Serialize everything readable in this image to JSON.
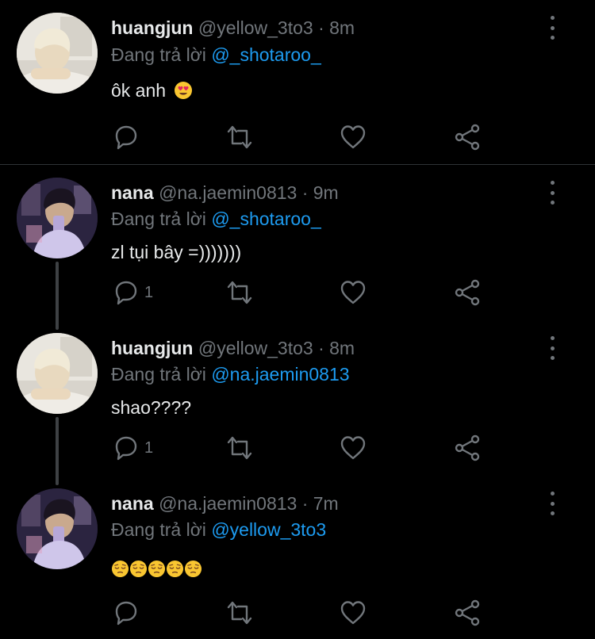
{
  "tweets": [
    {
      "name": "huangjun",
      "handle": "@yellow_3to3",
      "time": "· 8m",
      "reply_prefix": "Đang trả lời ",
      "reply_to": "@_shotaroo_",
      "text": "ôk anh",
      "emoji": "heart-eyes",
      "reply_count": ""
    },
    {
      "name": "nana",
      "handle": "@na.jaemin0813",
      "time": "· 9m",
      "reply_prefix": "Đang trả lời ",
      "reply_to": "@_shotaroo_",
      "text": "zl tụi bây =)))))))",
      "reply_count": "1"
    },
    {
      "name": "huangjun",
      "handle": "@yellow_3to3",
      "time": "· 8m",
      "reply_prefix": "Đang trả lời ",
      "reply_to": "@na.jaemin0813",
      "text": "shao????",
      "reply_count": "1"
    },
    {
      "name": "nana",
      "handle": "@na.jaemin0813",
      "time": "· 7m",
      "reply_prefix": "Đang trả lời ",
      "reply_to": "@yellow_3to3",
      "text": "",
      "emoji": "pensive x5",
      "reply_count": ""
    }
  ],
  "colors": {
    "background": "#000000",
    "text": "#e7e9ea",
    "muted": "#71767b",
    "mention": "#1d9bf0",
    "divider": "#2f3336"
  },
  "icons": [
    "reply-icon",
    "retweet-icon",
    "like-icon",
    "share-icon",
    "more-icon"
  ]
}
